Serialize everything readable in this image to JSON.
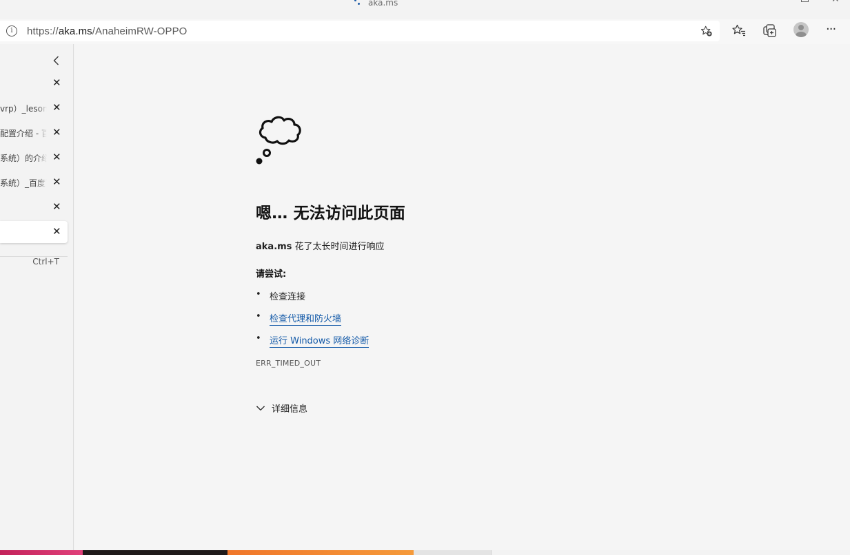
{
  "window": {
    "title": "aka.ms",
    "close_glyph": "✕"
  },
  "address_bar": {
    "url_prefix": "https://",
    "url_host": "aka.ms",
    "url_path": "/AnaheimRW-OPPO",
    "info_glyph": "i"
  },
  "toolbar": {
    "icons": [
      "add-favorite-icon",
      "favorites-icon",
      "collections-icon",
      "profile-icon",
      "more-icon"
    ],
    "more_glyph": "···"
  },
  "sidebar": {
    "tabs": [
      {
        "label": "",
        "active": false
      },
      {
        "label": "vrp）_leson-",
        "active": false
      },
      {
        "label": "配置介绍 - 百",
        "active": false
      },
      {
        "label": "系统）的介绍",
        "active": false
      },
      {
        "label": "系统）_百度百",
        "active": false
      },
      {
        "label": "",
        "active": false
      },
      {
        "label": "",
        "active": true
      }
    ],
    "close_glyph": "✕",
    "new_tab_shortcut": "Ctrl+T"
  },
  "error_page": {
    "title": "嗯… 无法访问此页面",
    "host": "aka.ms",
    "desc_suffix": " 花了太长时间进行响应",
    "try_label": "请尝试:",
    "suggestions": [
      {
        "text": "检查连接",
        "link": false
      },
      {
        "text": "检查代理和防火墙",
        "link": true
      },
      {
        "text": "运行 Windows 网络诊断",
        "link": true
      }
    ],
    "error_code": "ERR_TIMED_OUT",
    "details_label": "详细信息"
  },
  "colors": {
    "link": "#1259a8",
    "content_bg": "#f5f5f5",
    "sidebar_bg": "#f3f3f3"
  }
}
